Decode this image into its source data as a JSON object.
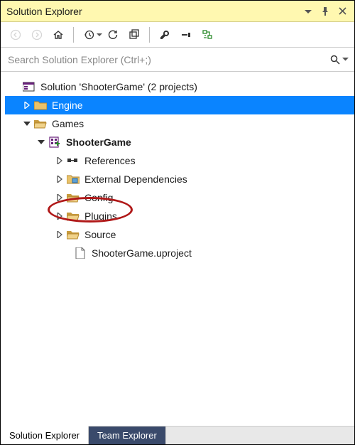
{
  "titlebar": {
    "title": "Solution Explorer"
  },
  "searchbar": {
    "placeholder": "Search Solution Explorer (Ctrl+;)"
  },
  "tree": {
    "solution_label": "Solution 'ShooterGame' (2 projects)",
    "engine_label": "Engine",
    "games_label": "Games",
    "project_label": "ShooterGame",
    "references_label": "References",
    "external_deps_label": "External Dependencies",
    "config_label": "Config",
    "plugins_label": "Plugins",
    "source_label": "Source",
    "uproject_label": "ShooterGame.uproject"
  },
  "tabs": {
    "solution_explorer": "Solution Explorer",
    "team_explorer": "Team Explorer"
  }
}
